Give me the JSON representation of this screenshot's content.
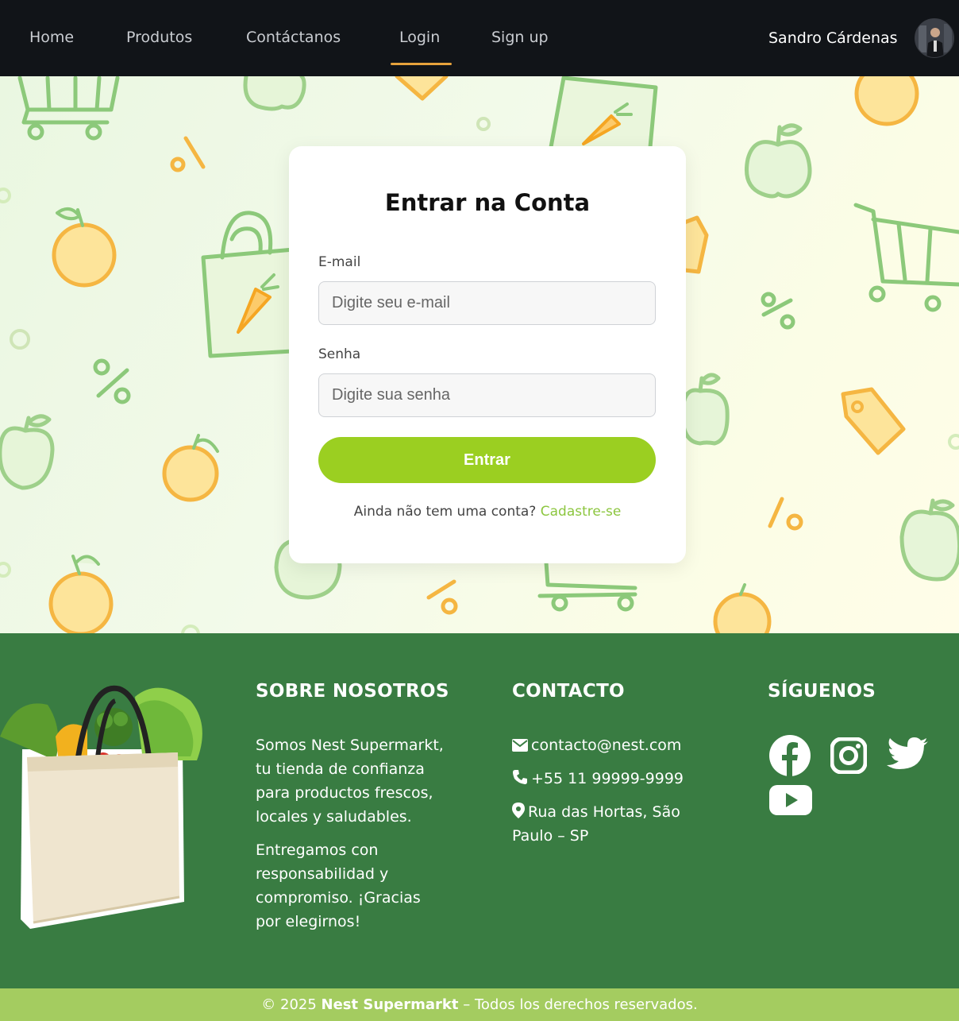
{
  "nav": {
    "items": [
      {
        "label": "Home"
      },
      {
        "label": "Produtos"
      },
      {
        "label": "Contáctanos"
      },
      {
        "label": "Login",
        "active": true
      },
      {
        "label": "Sign up"
      }
    ],
    "user_name": "Sandro Cárdenas"
  },
  "login": {
    "title": "Entrar na Conta",
    "email_label": "E-mail",
    "email_placeholder": "Digite seu e-mail",
    "password_label": "Senha",
    "password_placeholder": "Digite sua senha",
    "submit_label": "Entrar",
    "signup_prompt": "Ainda não tem uma conta?",
    "signup_link": "Cadastre-se"
  },
  "footer": {
    "about": {
      "heading": "SOBRE NOSOTROS",
      "paragraph1": "Somos Nest Supermarkt, tu tienda de confianza para productos frescos, locales y saludables.",
      "paragraph2": "Entregamos con responsabilidad y compromiso. ¡Gracias por elegirnos!"
    },
    "contact": {
      "heading": "CONTACTO",
      "email": "contacto@nest.com",
      "phone": "+55 11 99999-9999",
      "address": "Rua das Hortas, São Paulo – SP"
    },
    "social": {
      "heading": "SÍGUENOS",
      "icons": [
        "facebook-icon",
        "instagram-icon",
        "twitter-icon",
        "youtube-icon"
      ]
    },
    "copyright_prefix": "© 2025",
    "copyright_brand": "Nest Supermarkt",
    "copyright_suffix": "– Todos los derechos reservados."
  },
  "colors": {
    "nav_bg": "#111418",
    "accent_underline": "#e6a23c",
    "button": "#9bcf21",
    "link": "#8cc63f",
    "footer_bg": "#397c42",
    "bottom_bar": "#a4cc60"
  }
}
